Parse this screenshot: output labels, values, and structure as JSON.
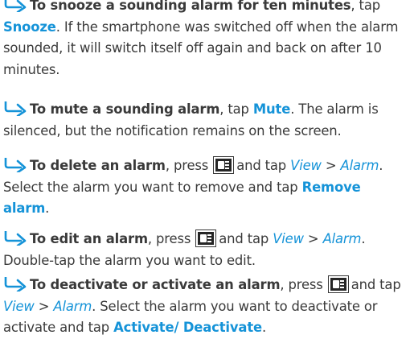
{
  "accent_color": "#1593d8",
  "text_color": "#3a3a3a",
  "icons": {
    "bullet": "right-arrow-bullet-icon",
    "menu_key": "menu-key-icon"
  },
  "items": [
    {
      "lead": "To snooze a sounding alarm for ten minutes",
      "t1": ", tap ",
      "ui1": "Snooze",
      "t2": ". If the smartphone was switched off when the alarm sounded, it will switch itself off again and back on after 10 minutes."
    },
    {
      "lead": "To mute a sounding alarm",
      "t1": ", tap ",
      "ui1": "Mute",
      "t2": ". The alarm is silenced, but the notification remains on the screen."
    },
    {
      "lead": "To delete an alarm",
      "t1": ", press",
      "t2": "and tap ",
      "menu1": "View",
      "sep": " > ",
      "menu2": "Alarm",
      "t3": ". Select the alarm you want to remove and tap ",
      "ui1": "Remove alarm",
      "t4": "."
    },
    {
      "lead": "To edit an alarm",
      "t1": ", press",
      "t2": "and tap ",
      "menu1": "View",
      "sep": " > ",
      "menu2": "Alarm",
      "t3": ". Double-tap the alarm you want to edit."
    },
    {
      "lead": "To deactivate or activate an alarm",
      "t1": ", press",
      "t2": "and tap ",
      "menu1": "View",
      "sep": " > ",
      "menu2": "Alarm",
      "t3": ". Select the alarm you want to deactivate or activate and tap ",
      "ui1": "Activate/ Deactivate",
      "t4": "."
    }
  ]
}
